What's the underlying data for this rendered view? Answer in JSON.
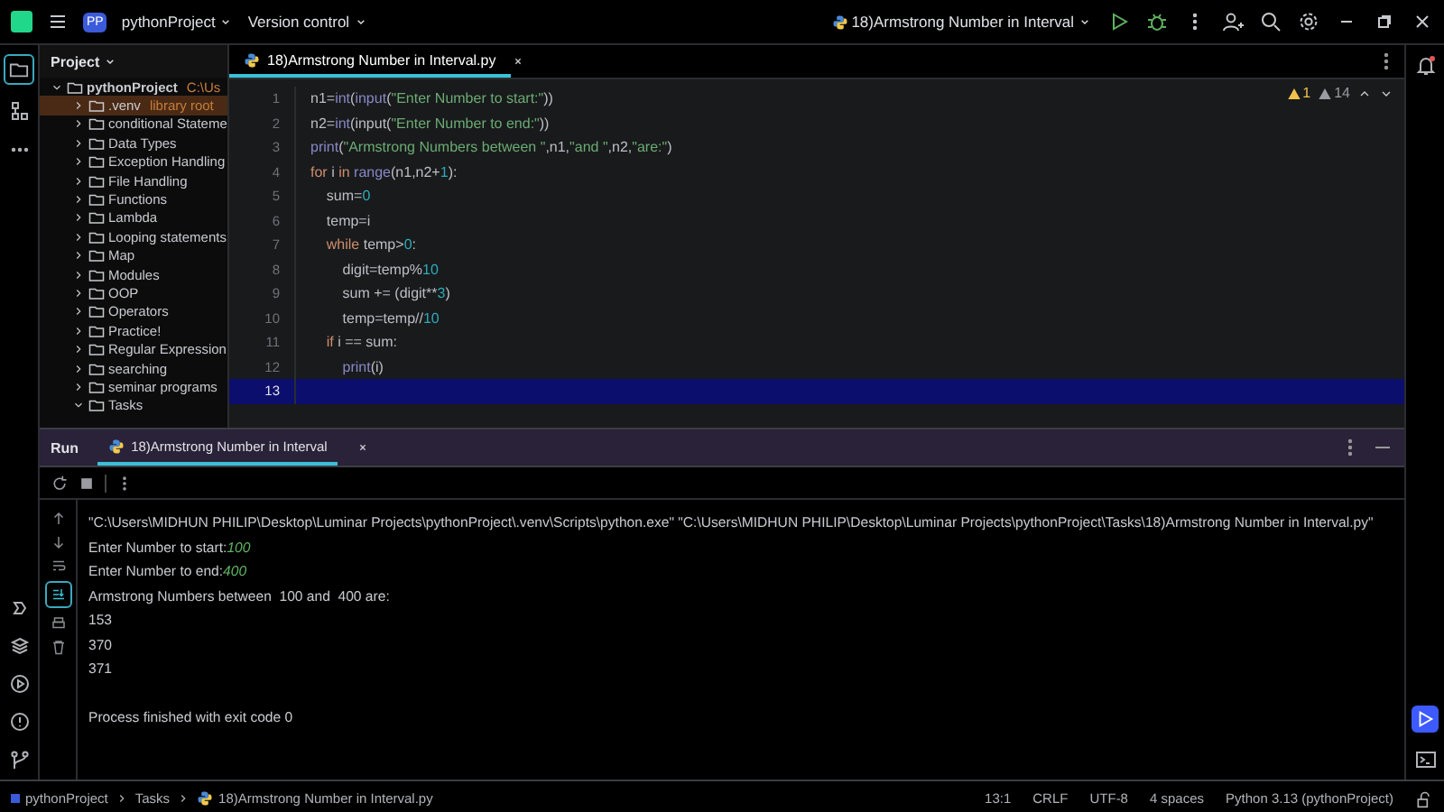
{
  "title_bar": {
    "project_badge": "PP",
    "project": "pythonProject",
    "vcs": "Version control",
    "run_config": "18)Armstrong Number in Interval"
  },
  "project_panel": {
    "title": "Project",
    "tree": [
      {
        "label": "pythonProject",
        "hint": "C:\\Us",
        "expanded": true,
        "selected": false,
        "children": [
          {
            "label": ".venv",
            "hint": "library root",
            "expanded": false,
            "selected": true
          },
          {
            "label": "conditional Stateme",
            "expanded": false,
            "selected": false
          },
          {
            "label": "Data Types",
            "expanded": false,
            "selected": false
          },
          {
            "label": "Exception Handling",
            "expanded": false,
            "selected": false
          },
          {
            "label": "File Handling",
            "expanded": false,
            "selected": false
          },
          {
            "label": "Functions",
            "expanded": false,
            "selected": false
          },
          {
            "label": "Lambda",
            "expanded": false,
            "selected": false
          },
          {
            "label": "Looping statements",
            "expanded": false,
            "selected": false
          },
          {
            "label": "Map",
            "expanded": false,
            "selected": false
          },
          {
            "label": "Modules",
            "expanded": false,
            "selected": false
          },
          {
            "label": "OOP",
            "expanded": false,
            "selected": false
          },
          {
            "label": "Operators",
            "expanded": false,
            "selected": false
          },
          {
            "label": "Practice!",
            "expanded": false,
            "selected": false
          },
          {
            "label": "Regular Expression",
            "expanded": false,
            "selected": false
          },
          {
            "label": "searching",
            "expanded": false,
            "selected": false
          },
          {
            "label": "seminar programs",
            "expanded": false,
            "selected": false
          },
          {
            "label": "Tasks",
            "expanded": true,
            "selected": false
          }
        ]
      }
    ]
  },
  "editor": {
    "tabs": [
      {
        "label": "18)Armstrong Number in Interval.py",
        "selected": true
      }
    ],
    "warnings": "1",
    "weak_warnings": "14",
    "lines": [
      {
        "number": "1",
        "current": false,
        "tokens": [
          {
            "kind": "plain",
            "t": "n1="
          },
          {
            "kind": "builtin",
            "t": "int"
          },
          {
            "kind": "plain",
            "t": "("
          },
          {
            "kind": "builtin",
            "t": "input"
          },
          {
            "kind": "plain",
            "t": "("
          },
          {
            "kind": "str",
            "t": "\"Enter Number to start:\""
          },
          {
            "kind": "plain",
            "t": "))"
          }
        ]
      },
      {
        "number": "2",
        "current": false,
        "tokens": [
          {
            "kind": "plain",
            "t": "n2="
          },
          {
            "kind": "builtin",
            "t": "int"
          },
          {
            "kind": "plain",
            "t": "(input("
          },
          {
            "kind": "str",
            "t": "\"Enter Number to end:\""
          },
          {
            "kind": "plain",
            "t": "))"
          }
        ]
      },
      {
        "number": "3",
        "current": false,
        "tokens": [
          {
            "kind": "builtin",
            "t": "print"
          },
          {
            "kind": "plain",
            "t": "("
          },
          {
            "kind": "str",
            "t": "\"Armstrong Numbers between \""
          },
          {
            "kind": "plain",
            "t": ",n1,"
          },
          {
            "kind": "str",
            "t": "\"and \""
          },
          {
            "kind": "plain",
            "t": ",n2,"
          },
          {
            "kind": "str",
            "t": "\"are:\""
          },
          {
            "kind": "plain",
            "t": ")"
          }
        ]
      },
      {
        "number": "4",
        "current": false,
        "tokens": [
          {
            "kind": "kw",
            "t": "for"
          },
          {
            "kind": "plain",
            "t": " i "
          },
          {
            "kind": "kw",
            "t": "in"
          },
          {
            "kind": "builtin",
            "t": " range"
          },
          {
            "kind": "plain",
            "t": "(n1,n2+"
          },
          {
            "kind": "num",
            "t": "1"
          },
          {
            "kind": "plain",
            "t": "):"
          }
        ]
      },
      {
        "number": "5",
        "current": false,
        "tokens": [
          {
            "kind": "plain",
            "t": "    sum="
          },
          {
            "kind": "num",
            "t": "0"
          }
        ]
      },
      {
        "number": "6",
        "current": false,
        "tokens": [
          {
            "kind": "plain",
            "t": "    temp=i"
          }
        ]
      },
      {
        "number": "7",
        "current": false,
        "tokens": [
          {
            "kind": "kw",
            "t": "    while"
          },
          {
            "kind": "plain",
            "t": " temp>"
          },
          {
            "kind": "num",
            "t": "0"
          },
          {
            "kind": "plain",
            "t": ":"
          }
        ]
      },
      {
        "number": "8",
        "current": false,
        "tokens": [
          {
            "kind": "plain",
            "t": "        digit=temp%"
          },
          {
            "kind": "num",
            "t": "10"
          }
        ]
      },
      {
        "number": "9",
        "current": false,
        "tokens": [
          {
            "kind": "plain",
            "t": "        sum += (digit**"
          },
          {
            "kind": "num",
            "t": "3"
          },
          {
            "kind": "plain",
            "t": ")"
          }
        ]
      },
      {
        "number": "10",
        "current": false,
        "tokens": [
          {
            "kind": "plain",
            "t": "        temp=temp//"
          },
          {
            "kind": "num",
            "t": "10"
          }
        ]
      },
      {
        "number": "11",
        "current": false,
        "tokens": [
          {
            "kind": "kw",
            "t": "    if"
          },
          {
            "kind": "plain",
            "t": " i == sum:"
          }
        ]
      },
      {
        "number": "12",
        "current": false,
        "tokens": [
          {
            "kind": "builtin",
            "t": "        print"
          },
          {
            "kind": "plain",
            "t": "(i)"
          }
        ]
      },
      {
        "number": "13",
        "current": true
      }
    ]
  },
  "run_panel": {
    "title": "Run",
    "tabs": [
      {
        "label": "18)Armstrong Number in Interval",
        "selected": true
      }
    ],
    "output": [
      {
        "kind": "command",
        "text": "\"C:\\Users\\MIDHUN PHILIP\\Desktop\\Luminar Projects\\pythonProject\\.venv\\Scripts\\python.exe\" \"C:\\Users\\MIDHUN PHILIP\\Desktop\\Luminar Projects\\pythonProject\\Tasks\\18)Armstrong Number in Interval.py\""
      },
      {
        "kind": "prompt",
        "text": "Enter Number to start:",
        "input": "100"
      },
      {
        "kind": "prompt",
        "text": "Enter Number to end:",
        "input": "400"
      },
      {
        "kind": "output",
        "text": "Armstrong Numbers between  100 and  400 are:"
      },
      {
        "kind": "output",
        "text": "153"
      },
      {
        "kind": "output",
        "text": "370"
      },
      {
        "kind": "output",
        "text": "371"
      },
      {
        "kind": "exit",
        "text": "Process finished with exit code 0"
      }
    ]
  },
  "status_bar": {
    "breadcrumbs": [
      {
        "kind": "project",
        "label": "pythonProject"
      },
      {
        "kind": "folder",
        "label": "Tasks"
      },
      {
        "kind": "file",
        "label": "18)Armstrong Number in Interval.py"
      }
    ],
    "items": [
      "13:1",
      "CRLF",
      "UTF-8",
      "4 spaces",
      "Python 3.13 (pythonProject)"
    ]
  }
}
